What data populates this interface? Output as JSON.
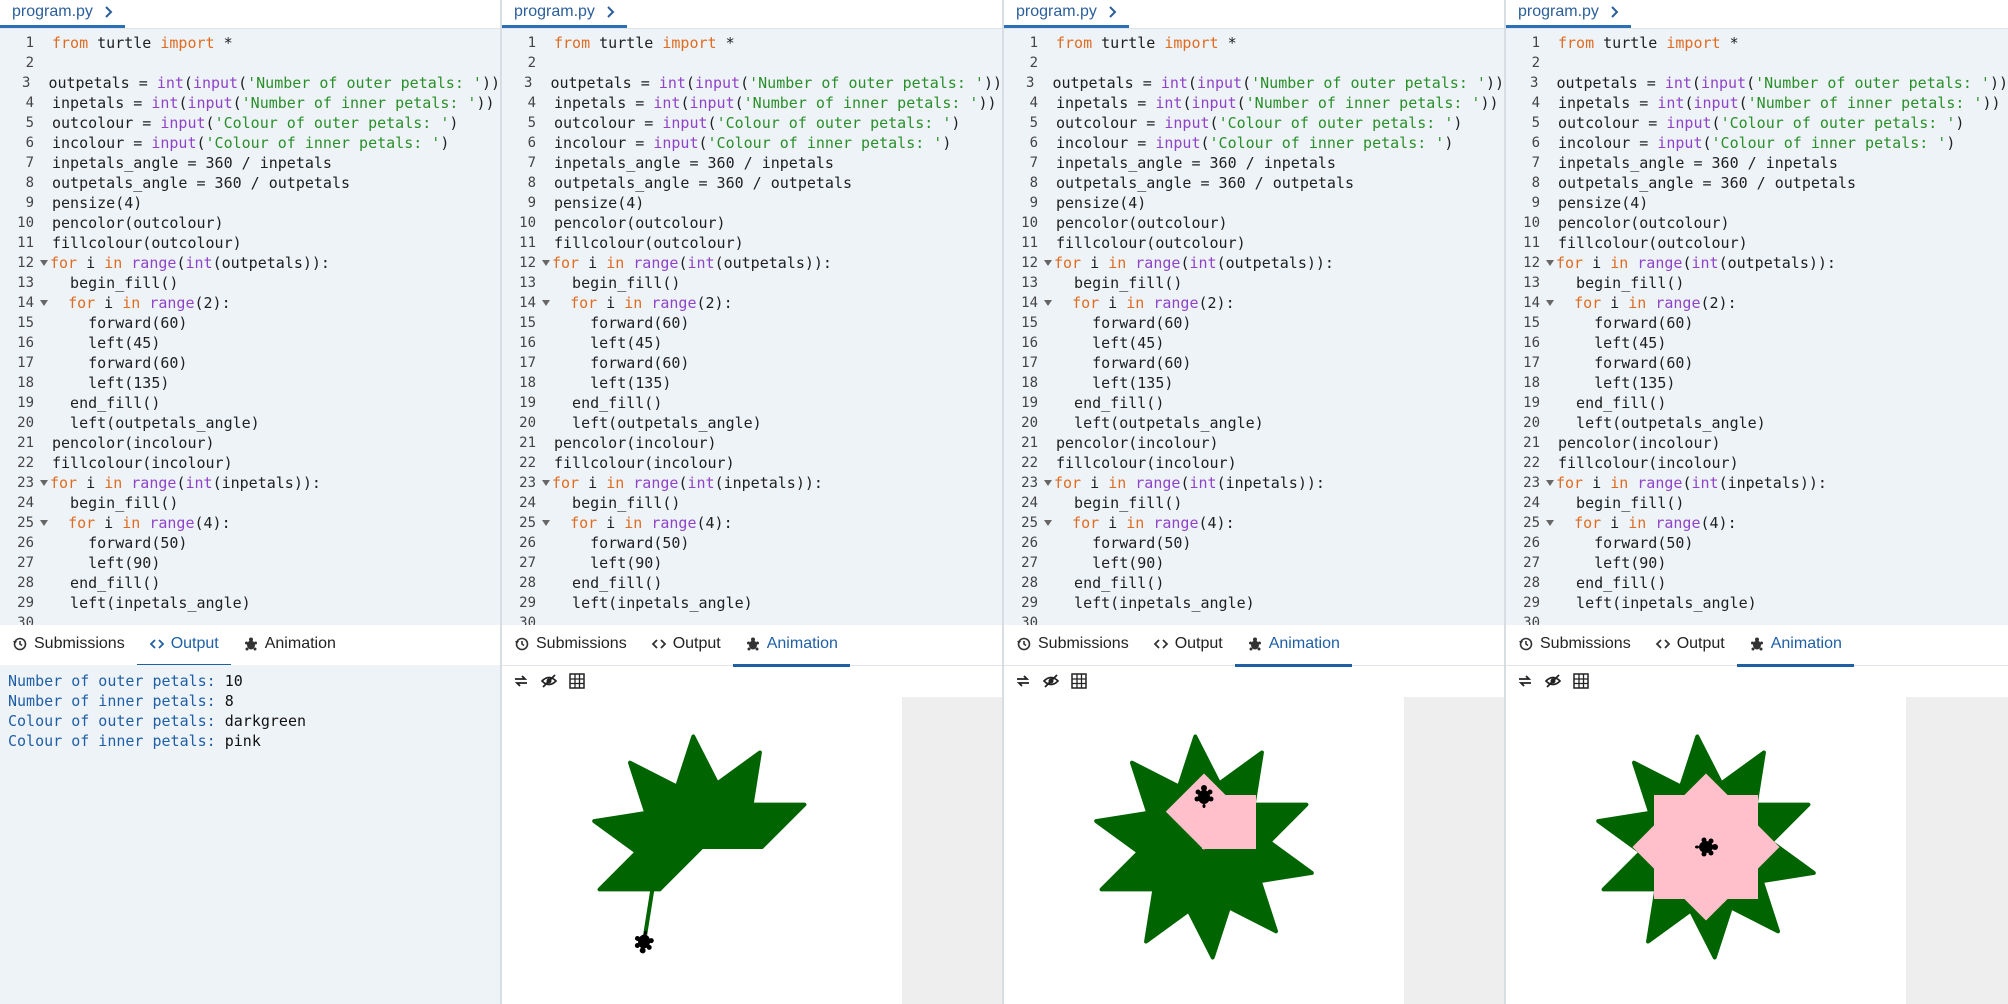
{
  "file_tab": {
    "label": "program.py"
  },
  "code_lines": [
    "from turtle import *",
    "",
    "outpetals = int(input('Number of outer petals: '))",
    "inpetals = int(input('Number of inner petals: '))",
    "outcolour = input('Colour of outer petals: ')",
    "incolour = input('Colour of inner petals: ')",
    "inpetals_angle = 360 / inpetals",
    "outpetals_angle = 360 / outpetals",
    "pensize(4)",
    "pencolor(outcolour)",
    "fillcolour(outcolour)",
    "for i in range(int(outpetals)):",
    "  begin_fill()",
    "  for i in range(2):",
    "    forward(60)",
    "    left(45)",
    "    forward(60)",
    "    left(135)",
    "  end_fill()",
    "  left(outpetals_angle)",
    "pencolor(incolour)",
    "fillcolour(incolour)",
    "for i in range(int(inpetals)):",
    "  begin_fill()",
    "  for i in range(4):",
    "    forward(50)",
    "    left(90)",
    "  end_fill()",
    "  left(inpetals_angle)",
    ""
  ],
  "tabs": {
    "submissions": "Submissions",
    "output": "Output",
    "animation": "Animation"
  },
  "output": {
    "lines": [
      {
        "label": "Number of outer petals: ",
        "value": "10"
      },
      {
        "label": "Number of inner petals: ",
        "value": "8"
      },
      {
        "label": "Colour of outer petals: ",
        "value": "darkgreen"
      },
      {
        "label": "Colour of inner petals: ",
        "value": "pink"
      }
    ]
  },
  "colors": {
    "outer": "#006400",
    "inner": "#ffc0cb",
    "accent": "#1f5fa6"
  },
  "panels": [
    {
      "active_tab": "output"
    },
    {
      "active_tab": "animation",
      "outer_petals_done": 6,
      "inner_petals_done": 0
    },
    {
      "active_tab": "animation",
      "outer_petals_done": 10,
      "inner_petals_done": 2
    },
    {
      "active_tab": "animation",
      "outer_petals_done": 10,
      "inner_petals_done": 8
    }
  ]
}
